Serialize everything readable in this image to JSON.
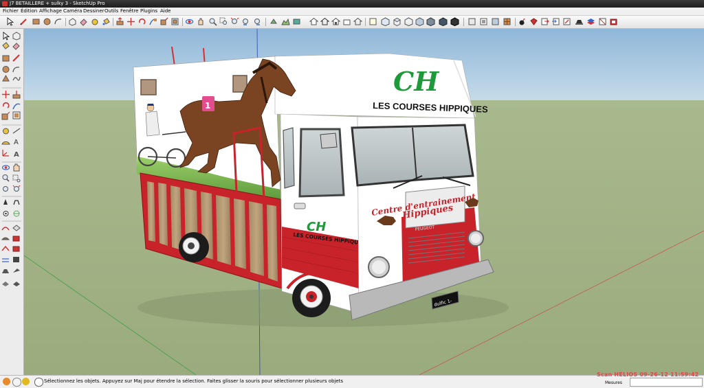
{
  "window": {
    "title": "J7 BETAILLERE + sulky 3 - SketchUp Pro"
  },
  "menu": [
    {
      "label": "Fichier"
    },
    {
      "label": "Édition"
    },
    {
      "label": "Affichage"
    },
    {
      "label": "Caméra"
    },
    {
      "label": "Dessiner"
    },
    {
      "label": "Outils"
    },
    {
      "label": "Fenêtre"
    },
    {
      "label": "Plugins"
    },
    {
      "label": "Aide"
    }
  ],
  "model": {
    "top_panel_text": "LES COURSES HIPPIQUES",
    "logo_text": "CH",
    "door_logo_text": "CH",
    "door_panel_text": "LES COURSES HIPPIQUES",
    "banner_line1": "Centre d'entrainement",
    "banner_line2": "Hippiques",
    "grille_brand": "PEUGEOT",
    "plate": "dulfic 1-",
    "saddle_number": "1"
  },
  "statusbar": {
    "message": "Sélectionnez les objets. Appuyez sur Maj pour étendre la sélection. Faites glisser la souris pour sélectionner plusieurs objets",
    "measure_label": "Mesures",
    "measure_value": ""
  },
  "watermark": "Scan HELIOS 09-26-12 11:59:42",
  "colors": {
    "sky": "#a9c8e1",
    "ground": "#a3b386",
    "body_red": "#c8232b",
    "logo_green": "#1f9a3a",
    "stamp_red": "#e0454a"
  }
}
